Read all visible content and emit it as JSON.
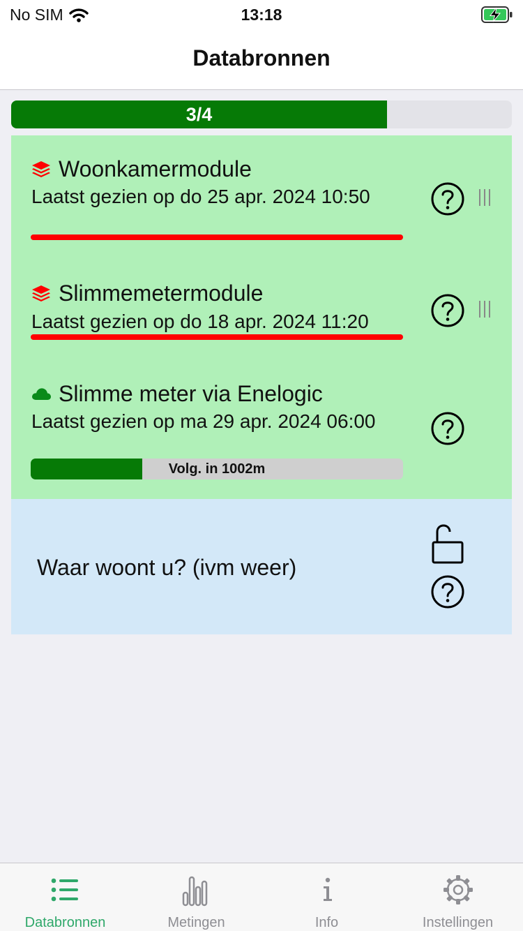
{
  "status_bar": {
    "carrier": "No SIM",
    "time": "13:18"
  },
  "nav": {
    "title": "Databronnen"
  },
  "progress": {
    "label": "3/4",
    "fraction": 0.75
  },
  "sources": [
    {
      "name": "Woonkamermodule",
      "last_seen": "Laatst gezien op do 25 apr. 2024 10:50",
      "icon": "layers-icon",
      "status_color": "#ff0000"
    },
    {
      "name": "Slimmemetermodule",
      "last_seen": "Laatst gezien op do 18 apr. 2024 11:20",
      "icon": "layers-icon",
      "status_color": "#ff0000"
    },
    {
      "name": "Slimme meter via Enelogic",
      "last_seen": "Laatst gezien op ma 29 apr. 2024 06:00",
      "icon": "cloud-icon",
      "next_update_label": "Volg. in 1002m",
      "next_update_fraction": 0.3
    }
  ],
  "location": {
    "label": "Waar woont u? (ivm weer)"
  },
  "tabs": [
    {
      "label": "Databronnen",
      "icon": "list-icon",
      "active": true
    },
    {
      "label": "Metingen",
      "icon": "bar-chart-icon",
      "active": false
    },
    {
      "label": "Info",
      "icon": "info-icon",
      "active": false
    },
    {
      "label": "Instellingen",
      "icon": "gear-icon",
      "active": false
    }
  ],
  "colors": {
    "accent_green": "#067a06",
    "sources_bg": "#b0f0b8",
    "location_bg": "#d3e8f8",
    "alert_red": "#ff0000",
    "tab_active": "#2fa86a"
  }
}
